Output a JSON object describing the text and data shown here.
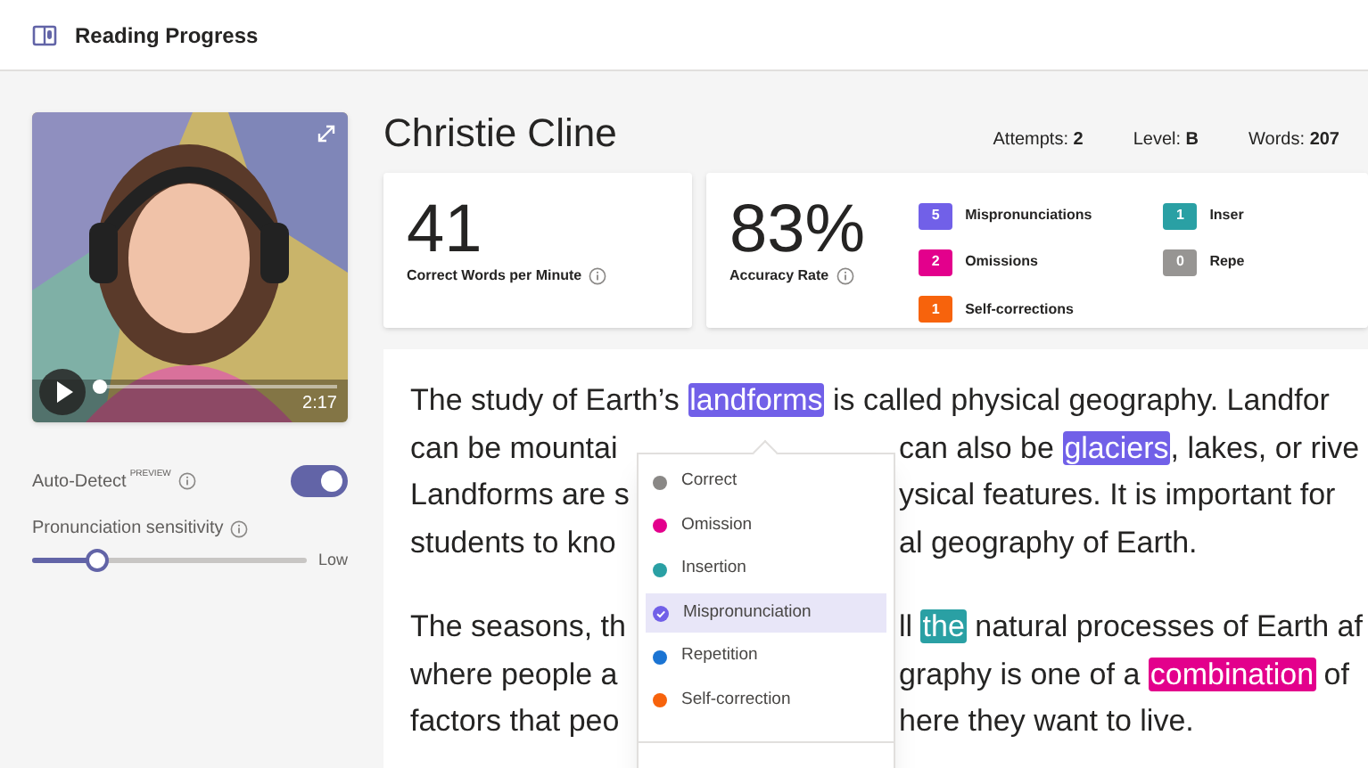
{
  "app": {
    "title": "Reading Progress"
  },
  "video": {
    "kind": "picture",
    "time": "2:17",
    "level": 0.03
  },
  "settings": {
    "auto_detect": {
      "label": "Auto-Detect",
      "badge": "PREVIEW",
      "on": true
    },
    "sensitivity": {
      "label": "Pronunciation sensitivity",
      "level": 0.23,
      "end_label": "Low"
    }
  },
  "student": {
    "name": "Christie Cline"
  },
  "summary": [
    {
      "label": "Attempts:",
      "value": "2"
    },
    {
      "label": "Level:",
      "value": "B"
    },
    {
      "label": "Words:",
      "value": "207"
    }
  ],
  "metrics": [
    {
      "value": "41",
      "label": "Correct Words per Minute"
    },
    {
      "value": "83%",
      "label": "Accuracy Rate"
    }
  ],
  "error_counts": [
    {
      "count": "5",
      "label": "Mispronunciations",
      "color": "#7160e8"
    },
    {
      "count": "2",
      "label": "Omissions",
      "color": "#e3008c"
    },
    {
      "count": "1",
      "label": "Self-corrections",
      "color": "#f7630c"
    },
    {
      "count": "1",
      "label": "Inser",
      "color": "#2aa0a4"
    },
    {
      "count": "0",
      "label": "Repe",
      "color": "#979593"
    }
  ],
  "passage": {
    "lines": [
      {
        "left": [
          {
            "text": "The study of Earth’s "
          },
          {
            "text": "landforms",
            "color": "#7160e8"
          },
          {
            "text": " is called physical geography. Landfor"
          }
        ]
      },
      {
        "left": [
          {
            "text": "can be mountai"
          }
        ],
        "right": [
          {
            "text": "can also be "
          },
          {
            "text": "glaciers",
            "color": "#7160e8"
          },
          {
            "text": ", lakes, or rive"
          }
        ]
      },
      {
        "left": [
          {
            "text": "Landforms are s"
          }
        ],
        "right": [
          {
            "text": "ysical features. It is important for"
          }
        ]
      },
      {
        "left": [
          {
            "text": "students to kno"
          }
        ],
        "right": [
          {
            "text": "al geography of Earth."
          }
        ]
      },
      {
        "left": [
          {
            "text": "The seasons, th"
          }
        ],
        "right": [
          {
            "text": "ll "
          },
          {
            "text": "the",
            "color": "#2aa0a4"
          },
          {
            "text": " natural processes of Earth af"
          }
        ],
        "gap_before": true
      },
      {
        "left": [
          {
            "text": "where people a"
          }
        ],
        "right": [
          {
            "text": "graphy is one of a "
          },
          {
            "text": "combination",
            "color": "#e3008c"
          },
          {
            "text": " of"
          }
        ]
      },
      {
        "left": [
          {
            "text": "factors that peo"
          }
        ],
        "right": [
          {
            "text": "here they want to live."
          }
        ]
      }
    ]
  },
  "menu": {
    "items": [
      {
        "label": "Correct",
        "color": "#8a8886",
        "selected": false
      },
      {
        "label": "Omission",
        "color": "#e3008c",
        "selected": false
      },
      {
        "label": "Insertion",
        "color": "#2aa0a4",
        "selected": false
      },
      {
        "label": "Mispronunciation",
        "color": "#7160e8",
        "selected": true
      },
      {
        "label": "Repetition",
        "color": "#1b74d3",
        "selected": false
      },
      {
        "label": "Self-correction",
        "color": "#f7630c",
        "selected": false
      }
    ]
  }
}
